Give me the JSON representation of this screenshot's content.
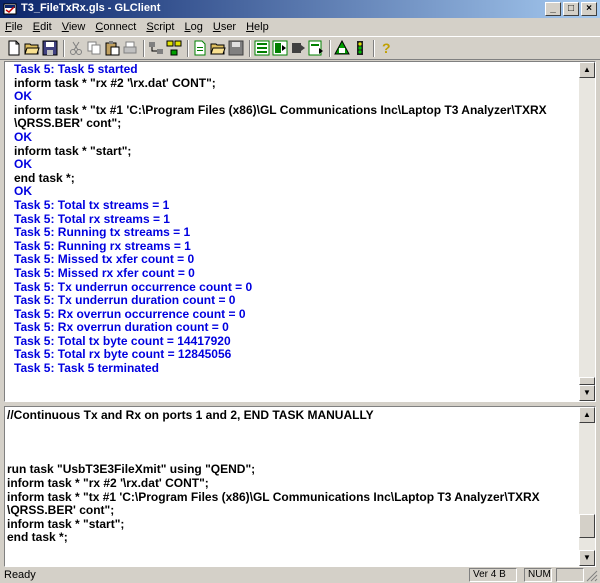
{
  "window": {
    "title": "T3_FileTxRx.gls - GLClient",
    "minimize_label": "_",
    "maximize_label": "□",
    "close_label": "×"
  },
  "menu": [
    "File",
    "Edit",
    "View",
    "Connect",
    "Script",
    "Log",
    "User",
    "Help"
  ],
  "toolbar_icons": [
    "new-file-icon",
    "open-folder-icon",
    "save-icon",
    "cut-icon",
    "copy-icon",
    "paste-icon",
    "print-icon",
    "connect-icon",
    "network-icon",
    "new-script-icon",
    "open-script-icon",
    "save-script-icon",
    "run-script-icon",
    "stop-script-icon",
    "step-icon",
    "pause-icon",
    "users-icon",
    "traffic-light-icon",
    "help-icon"
  ],
  "output_pane": {
    "lines": [
      {
        "text": "Task 5: Task 5 started",
        "color": "blue"
      },
      {
        "text": "inform task * \"rx #2 '\\rx.dat' CONT\";",
        "color": "black"
      },
      {
        "text": "OK",
        "color": "blue"
      },
      {
        "text": "inform task * \"tx #1 'C:\\Program Files (x86)\\GL Communications Inc\\Laptop T3 Analyzer\\TXRX",
        "color": "black"
      },
      {
        "text": "\\QRSS.BER' cont\";",
        "color": "black"
      },
      {
        "text": "OK",
        "color": "blue"
      },
      {
        "text": "inform task * \"start\";",
        "color": "black"
      },
      {
        "text": "OK",
        "color": "blue"
      },
      {
        "text": "end task *;",
        "color": "black"
      },
      {
        "text": "OK",
        "color": "blue"
      },
      {
        "text": "Task 5: Total tx streams = 1",
        "color": "blue"
      },
      {
        "text": "Task 5: Total rx streams = 1",
        "color": "blue"
      },
      {
        "text": "Task 5: Running tx streams = 1",
        "color": "blue"
      },
      {
        "text": "Task 5: Running rx streams = 1",
        "color": "blue"
      },
      {
        "text": "Task 5: Missed tx xfer count = 0",
        "color": "blue"
      },
      {
        "text": "Task 5: Missed rx xfer count = 0",
        "color": "blue"
      },
      {
        "text": "Task 5: Tx underrun occurrence count = 0",
        "color": "blue"
      },
      {
        "text": "Task 5: Tx underrun duration count = 0",
        "color": "blue"
      },
      {
        "text": "Task 5: Rx overrun occurrence count = 0",
        "color": "blue"
      },
      {
        "text": "Task 5: Rx overrun duration count = 0",
        "color": "blue"
      },
      {
        "text": "Task 5: Total tx byte count = 14417920",
        "color": "blue"
      },
      {
        "text": "Task 5: Total rx byte count = 12845056",
        "color": "blue"
      },
      {
        "text": "Task 5: Task 5 terminated",
        "color": "blue"
      }
    ]
  },
  "script_pane": {
    "lines": [
      "//Continuous Tx and Rx on ports 1 and 2, END TASK MANUALLY",
      "",
      "",
      "",
      "run task \"UsbT3E3FileXmit\" using \"QEND\";",
      "inform task * \"rx #2 '\\rx.dat' CONT\";",
      "inform task * \"tx #1 'C:\\Program Files (x86)\\GL Communications Inc\\Laptop T3 Analyzer\\TXRX",
      "\\QRSS.BER' cont\";",
      "inform task * \"start\";",
      "end task *;"
    ]
  },
  "status": {
    "ready": "Ready",
    "version": "Ver 4 B",
    "num": "NUM"
  },
  "colors": {
    "blue_text": "#0000e0",
    "black_text": "#000000",
    "title_start": "#0a246a",
    "title_end": "#a6caf0"
  }
}
